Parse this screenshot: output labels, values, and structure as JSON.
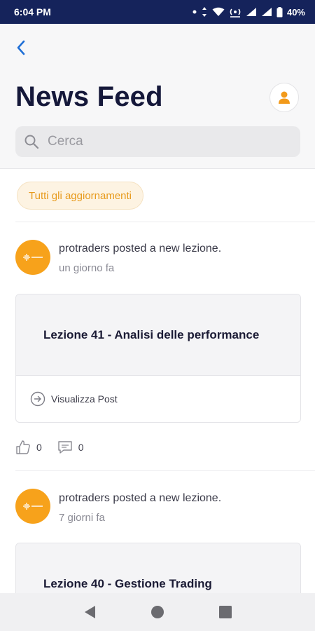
{
  "status_bar": {
    "time": "6:04 PM",
    "battery": "40%",
    "icons": [
      "dot-icon",
      "data-arrows-icon",
      "wifi-icon",
      "hotspot-icon",
      "signal-icon",
      "signal-icon",
      "battery-icon"
    ]
  },
  "header": {
    "title": "News Feed",
    "back_icon": "chevron-left-icon",
    "profile_icon": "user-icon"
  },
  "search": {
    "placeholder": "Cerca",
    "value": ""
  },
  "filter": {
    "label": "Tutti gli aggiornamenti"
  },
  "posts": [
    {
      "author_line": "protraders posted a new lezione.",
      "time": "un giorno fa",
      "card_title": "Lezione 41 - Analisi delle performance",
      "view_label": "Visualizza Post",
      "likes": "0",
      "comments": "0"
    },
    {
      "author_line": "protraders posted a new lezione.",
      "time": "7 giorni fa",
      "card_title": "Lezione 40 - Gestione Trading"
    }
  ],
  "colors": {
    "status_bar": "#15235b",
    "accent": "#f7a21b",
    "back": "#1f6fd6"
  }
}
